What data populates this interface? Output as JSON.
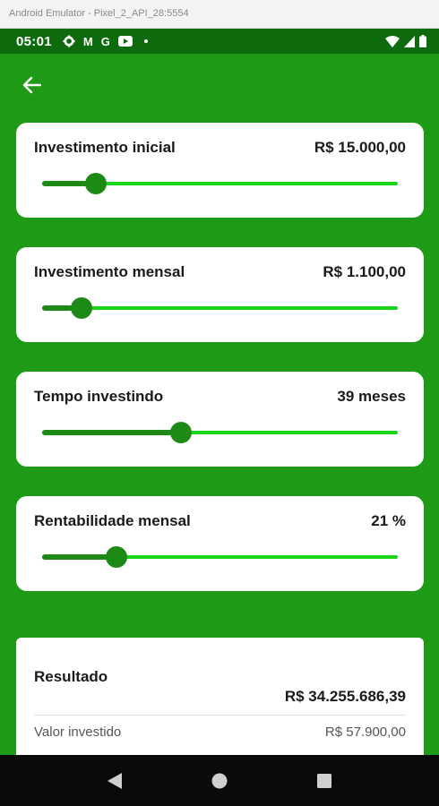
{
  "emulator": {
    "title": "Android Emulator - Pixel_2_API_28:5554"
  },
  "status_bar": {
    "time": "05:01",
    "mail_letter": "M",
    "google_letter": "G"
  },
  "cards": [
    {
      "label": "Investimento inicial",
      "value": "R$ 15.000,00",
      "slider_fraction": 0.15
    },
    {
      "label": "Investimento mensal",
      "value": "R$ 1.100,00",
      "slider_fraction": 0.11
    },
    {
      "label": "Tempo investindo",
      "value": "39 meses",
      "slider_fraction": 0.39
    },
    {
      "label": "Rentabilidade mensal",
      "value": "21 %",
      "slider_fraction": 0.21
    }
  ],
  "result": {
    "title": "Resultado",
    "total": "R$ 34.255.686,39",
    "invested_label": "Valor investido",
    "invested_value": "R$ 57.900,00"
  },
  "colors": {
    "app_background": "#1f9a16",
    "status_bar": "#0d6b0d",
    "slider_active": "#1e8a16",
    "slider_inactive": "#19d419"
  }
}
